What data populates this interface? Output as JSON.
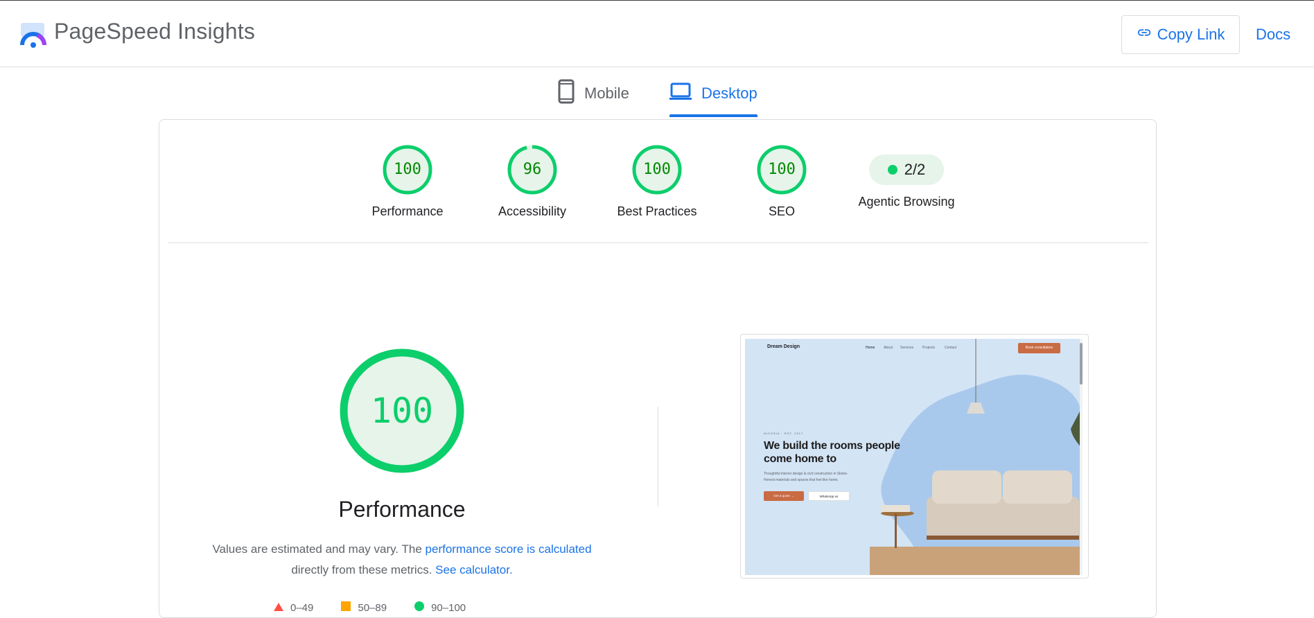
{
  "header": {
    "app_title": "PageSpeed Insights",
    "copy_link_label": "Copy Link",
    "docs_label": "Docs"
  },
  "tabs": [
    {
      "label": "Mobile",
      "icon": "smartphone-icon",
      "active": false
    },
    {
      "label": "Desktop",
      "icon": "laptop-icon",
      "active": true
    }
  ],
  "scores": [
    {
      "label": "Performance",
      "value": "100"
    },
    {
      "label": "Accessibility",
      "value": "96"
    },
    {
      "label": "Best Practices",
      "value": "100"
    },
    {
      "label": "SEO",
      "value": "100"
    }
  ],
  "agentic": {
    "label": "Agentic Browsing",
    "value": "2/2"
  },
  "performance": {
    "score": "100",
    "title": "Performance",
    "desc_prefix": "Values are estimated and may vary. The ",
    "desc_link1": "performance score is calculated",
    "desc_middle": "directly from these metrics.",
    "desc_link2": "See calculator.",
    "legend": [
      {
        "label": "0–49",
        "shape": "triangle",
        "color": "#ff4e42"
      },
      {
        "label": "50–89",
        "shape": "square",
        "color": "#ffa400"
      },
      {
        "label": "90–100",
        "shape": "circle",
        "color": "#0cce6b"
      }
    ]
  },
  "screenshot": {
    "brand": "Dream Design",
    "nav_links": [
      "Home",
      "About",
      "Services",
      "Projects",
      "Contact"
    ],
    "cta": "Book consultation",
    "kicker": "NICOSIA · EST. 2017",
    "headline": "We build the rooms people come home to",
    "sub": "Thoughtful interior design & civil construction in Skirne. Honest materials and spaces that feel like home.",
    "btn1": "Get a quote  →",
    "btn2": "WhatsApp us"
  },
  "colors": {
    "pass": "#0cce6b",
    "pass_text": "#008800",
    "pass_bg": "#e6f4ea",
    "accent": "#1a73e8"
  }
}
